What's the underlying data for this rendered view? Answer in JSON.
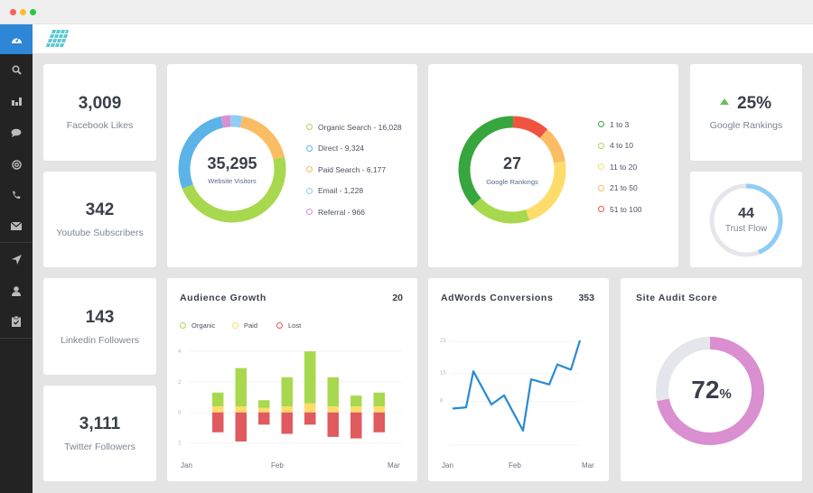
{
  "window": {
    "controls": [
      "close",
      "minimize",
      "maximize"
    ],
    "control_colors": [
      "#fc5f57",
      "#fdbc2e",
      "#28c840"
    ]
  },
  "sidebar": {
    "active_item": "dashboard-icon",
    "items": [
      {
        "icon": "dashboard-icon"
      },
      {
        "icon": "search-icon"
      },
      {
        "icon": "bar-chart-icon"
      },
      {
        "icon": "chat-bubble-icon"
      },
      {
        "icon": "at-sign-icon"
      },
      {
        "icon": "phone-icon"
      },
      {
        "icon": "envelope-icon"
      },
      {
        "icon": "paper-plane-icon"
      },
      {
        "icon": "user-icon"
      },
      {
        "icon": "clipboard-check-icon"
      }
    ]
  },
  "logo": {
    "icon": "grid-logo-icon",
    "color": "#5cc8d0"
  },
  "stats": {
    "facebook": {
      "value": "3,009",
      "label": "Facebook Likes"
    },
    "youtube": {
      "value": "342",
      "label": "Youtube Subscribers"
    },
    "linkedin": {
      "value": "143",
      "label": "Linkedin Followers"
    },
    "twitter": {
      "value": "3,111",
      "label": "Twitter Followers"
    }
  },
  "visitors": {
    "total": "35,295",
    "label": "Website Visitors",
    "legend": [
      {
        "label": "Organic Search - 16,028",
        "color": "#a8d84e"
      },
      {
        "label": "Direct - 9,324",
        "color": "#5bb3e8"
      },
      {
        "label": "Paid Search - 6,177",
        "color": "#fbbd63"
      },
      {
        "label": "Email - 1,228",
        "color": "#8fcdf5"
      },
      {
        "label": "Referral - 966",
        "color": "#d98fd0"
      }
    ]
  },
  "rankings": {
    "total": "27",
    "label": "Google Rankings",
    "legend": [
      {
        "label": "1 to 3",
        "color": "#37a63e"
      },
      {
        "label": "4 to 10",
        "color": "#a8d84e"
      },
      {
        "label": "11 to 20",
        "color": "#fddc6a"
      },
      {
        "label": "21 to 50",
        "color": "#fbbd63"
      },
      {
        "label": "51 to 100",
        "color": "#f0533f"
      }
    ]
  },
  "ranking_change": {
    "value": "25%",
    "label": "Google Rankings",
    "direction": "up",
    "arrow_color": "#6bbf5b"
  },
  "trust_flow": {
    "value": "44",
    "label": "Trust Flow",
    "fraction": 0.44,
    "color": "#8fcdf5"
  },
  "site_audit": {
    "title": "Site Audit Score",
    "value": "72",
    "unit": "%",
    "fraction": 0.72,
    "color": "#d98fd0"
  },
  "chart_data": [
    {
      "type": "donut",
      "title": "Website Visitors",
      "categories": [
        "Organic Search",
        "Direct",
        "Paid Search",
        "Email",
        "Referral"
      ],
      "values": [
        16028,
        9324,
        6177,
        1228,
        966
      ],
      "colors": [
        "#a8d84e",
        "#5bb3e8",
        "#fbbd63",
        "#8fcdf5",
        "#d98fd0"
      ]
    },
    {
      "type": "donut",
      "title": "Google Rankings",
      "categories": [
        "1 to 3",
        "4 to 10",
        "11 to 20",
        "21 to 50",
        "51 to 100"
      ],
      "values": [
        10,
        5,
        6,
        3,
        3
      ],
      "colors": [
        "#37a63e",
        "#a8d84e",
        "#fddc6a",
        "#fbbd63",
        "#f0533f"
      ]
    },
    {
      "type": "bar",
      "title": "Audience Growth",
      "total": "20",
      "legend": [
        {
          "label": "Organic",
          "color": "#a8d84e"
        },
        {
          "label": "Paid",
          "color": "#fddc6a"
        },
        {
          "label": "Lost",
          "color": "#e05a5f"
        }
      ],
      "series": [
        {
          "name": "Organic",
          "values": [
            0.9,
            2.5,
            0.5,
            1.9,
            3.4,
            1.9,
            0.7,
            0.9
          ]
        },
        {
          "name": "Paid",
          "values": [
            0.4,
            0.4,
            0.3,
            0.4,
            0.6,
            0.4,
            0.4,
            0.4
          ]
        },
        {
          "name": "Lost",
          "values": [
            -1.3,
            -1.9,
            -0.8,
            -1.4,
            -0.8,
            -1.6,
            -1.7,
            -1.3
          ]
        }
      ],
      "yticks": [
        "4",
        "2",
        "0",
        "2"
      ],
      "ylim": [
        -2.2,
        4.3
      ],
      "xlabels": [
        "Jan",
        "Feb",
        "Mar"
      ],
      "grid": true
    },
    {
      "type": "line",
      "title": "AdWords Conversions",
      "total": "353",
      "values": [
        6,
        6.3,
        15.3,
        7,
        9.3,
        0.5,
        13.3,
        12,
        17,
        15.7,
        23
      ],
      "color": "#2a8ad2",
      "yticks": [
        "23",
        "15",
        "8"
      ],
      "ylim": [
        0,
        23
      ],
      "xlabels": [
        "Jan",
        "Feb",
        "Mar"
      ],
      "grid": true
    }
  ],
  "audience": {
    "title": "Audience Growth",
    "total": "20",
    "legend": [
      "Organic",
      "Paid",
      "Lost"
    ],
    "x": [
      "Jan",
      "Feb",
      "Mar"
    ],
    "y": [
      "4",
      "2",
      "0",
      "2"
    ]
  },
  "adwords": {
    "title": "AdWords Conversions",
    "total": "353",
    "x": [
      "Jan",
      "Feb",
      "Mar"
    ],
    "y": [
      "23",
      "15",
      "8"
    ]
  }
}
